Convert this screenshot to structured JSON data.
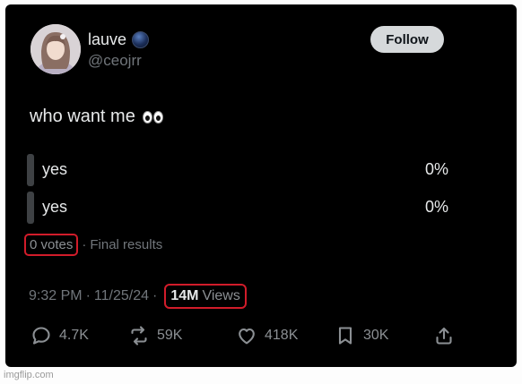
{
  "author": {
    "display_name": "lauve",
    "handle": "@ceojrr",
    "badge_icon": "dark-globe-badge-icon"
  },
  "follow_label": "Follow",
  "post": {
    "text": "who want me",
    "emoji": "eyes-emoji"
  },
  "poll": {
    "options": [
      {
        "label": "yes",
        "percent": "0%"
      },
      {
        "label": "yes",
        "percent": "0%"
      }
    ],
    "votes": "0 votes",
    "separator": "·",
    "status": "Final results"
  },
  "meta": {
    "time": "9:32 PM",
    "separator": "·",
    "date": "11/25/24",
    "views_count": "14M",
    "views_label": "Views"
  },
  "actions": {
    "replies": "4.7K",
    "reposts": "59K",
    "likes": "418K",
    "bookmarks": "30K"
  },
  "watermark": "imgflip.com",
  "colors": {
    "background": "#000000",
    "highlight": "#d11c2a",
    "muted_text": "#71767b",
    "primary_text": "#e7e9ea"
  }
}
